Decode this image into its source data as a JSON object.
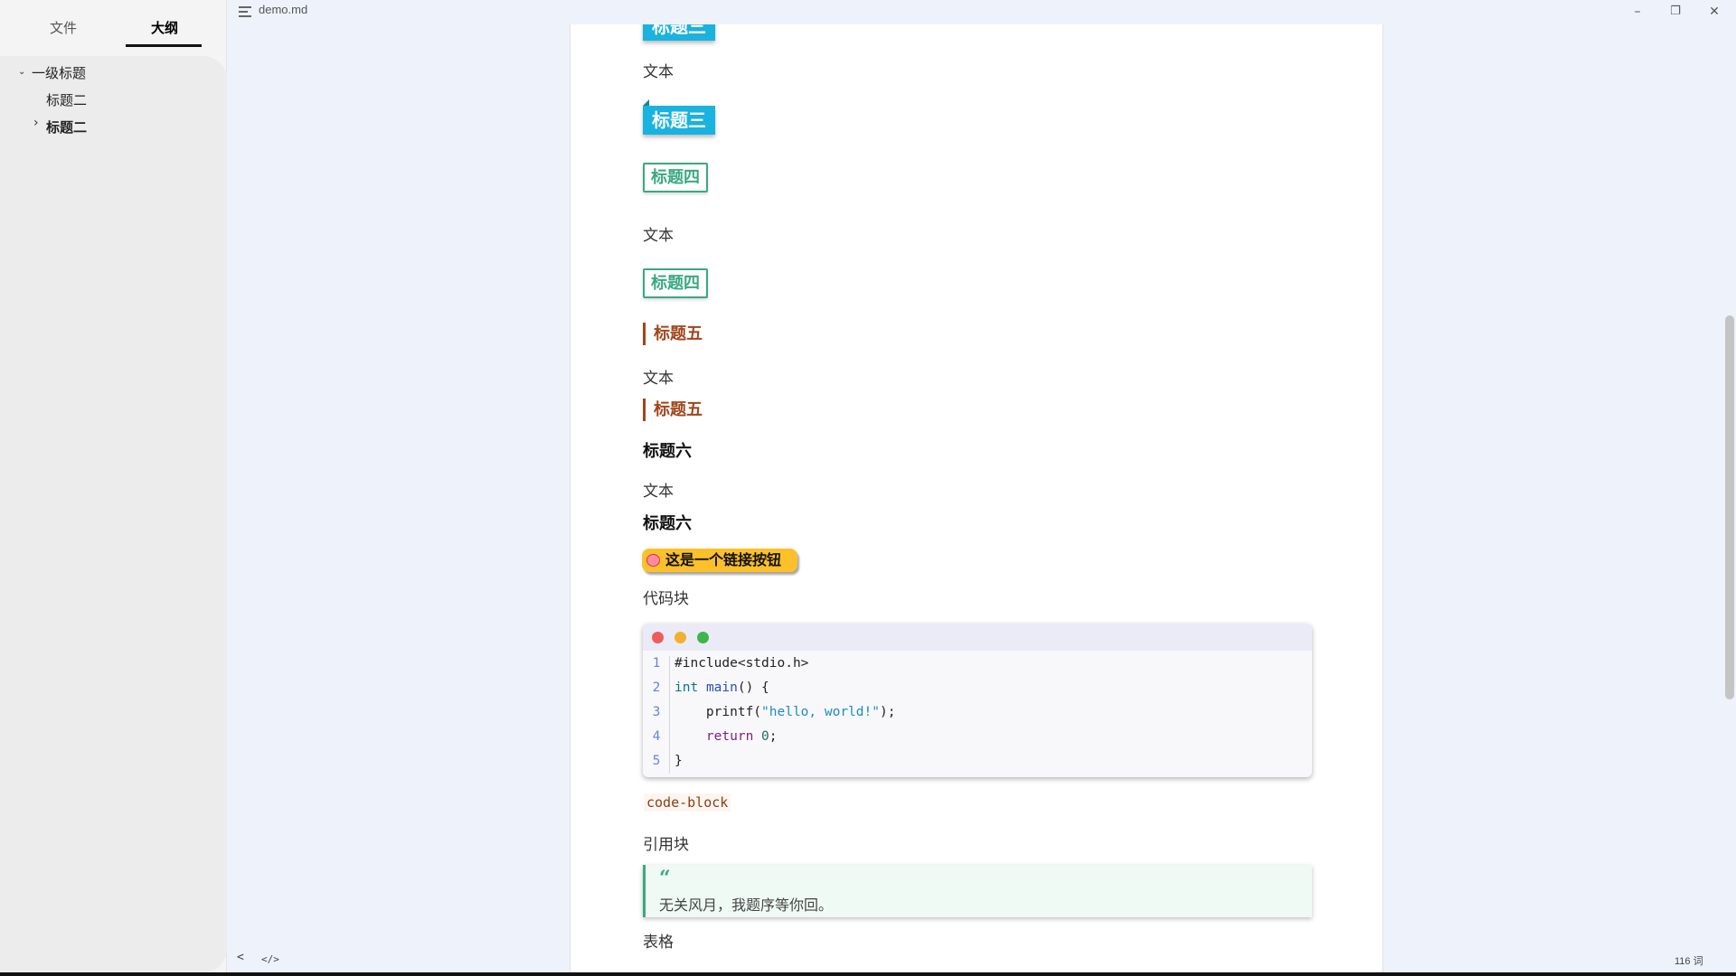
{
  "sidebar": {
    "tabs": [
      {
        "label": "文件"
      },
      {
        "label": "大纲"
      }
    ],
    "outline": [
      {
        "label": "一级标题",
        "chevron": "⌄"
      },
      {
        "label": "标题二",
        "chevron": ""
      },
      {
        "label": "标题二",
        "chevron": "›"
      }
    ]
  },
  "titlebar": {
    "title": "demo.md",
    "menu_icon": "menu-icon",
    "buttons": {
      "minimize": "–",
      "restore": "❐",
      "close": "✕"
    }
  },
  "document": {
    "h3_partial": "标题三",
    "text": "文本",
    "h3": "标题三",
    "h4": "标题四",
    "h5": "标题五",
    "h6": "标题六",
    "link_button": "这是一个链接按钮",
    "code_label": "代码块",
    "code": {
      "line_numbers": [
        "1",
        "2",
        "3",
        "4",
        "5"
      ],
      "lines": {
        "l1": "#include<stdio.h>",
        "l2_kw": "int",
        "l2_fn": "main",
        "l2_rest": "() {",
        "l3_fn": "printf(",
        "l3_str": "\"hello, world!\"",
        "l3_rest": ");",
        "l4_kw": "return",
        "l4_num": "0",
        "l4_rest": ";",
        "l5": "}"
      },
      "dot_colors": [
        "#ee5d5a",
        "#f1b12f",
        "#3cb64a"
      ]
    },
    "inline_code": "code-block",
    "quote_label": "引用块",
    "quote_mark": "“",
    "quote_text": "无关风月，我题序等你回。",
    "table_label": "表格"
  },
  "status": {
    "collapse_icon": "<",
    "source_icon": "</>",
    "word_count": "116 词"
  },
  "colors": {
    "h3_bg": "#1ab2de",
    "h4": "#3aa980",
    "h5": "#a0451c",
    "link_bg": "#fcc02a"
  }
}
